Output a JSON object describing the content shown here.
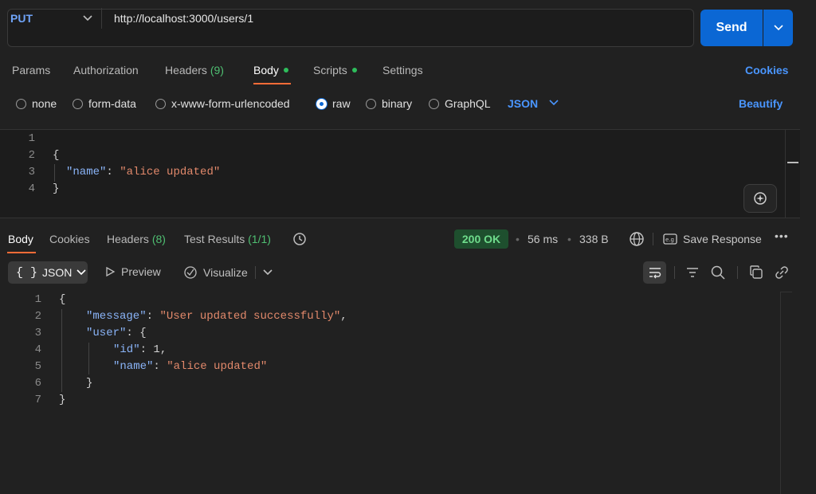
{
  "request": {
    "method": "PUT",
    "url": "http://localhost:3000/users/1",
    "send_label": "Send"
  },
  "request_tabs": [
    {
      "label": "Params"
    },
    {
      "label": "Authorization"
    },
    {
      "label": "Headers",
      "count": "(9)"
    },
    {
      "label": "Body",
      "active": true
    },
    {
      "label": "Scripts"
    },
    {
      "label": "Settings"
    }
  ],
  "cookies_label": "Cookies",
  "body_types": [
    "none",
    "form-data",
    "x-www-form-urlencoded",
    "raw",
    "binary",
    "GraphQL"
  ],
  "selected_body_type": "raw",
  "raw_format": "JSON",
  "beautify_label": "Beautify",
  "request_body": {
    "line_numbers": [
      "1",
      "2",
      "3",
      "4"
    ],
    "key": "\"name\"",
    "value": "\"alice updated\""
  },
  "response_tabs": [
    {
      "label": "Body",
      "active": true
    },
    {
      "label": "Cookies"
    },
    {
      "label": "Headers",
      "count": "(8)"
    },
    {
      "label": "Test Results",
      "count": "(1/1)"
    }
  ],
  "response_meta": {
    "status": "200 OK",
    "time": "56 ms",
    "size": "338 B",
    "save_label": "Save Response"
  },
  "response_toolbar": {
    "format": "JSON",
    "preview": "Preview",
    "visualize": "Visualize"
  },
  "response_body": {
    "line_numbers": [
      "1",
      "2",
      "3",
      "4",
      "5",
      "6",
      "7"
    ],
    "message_key": "\"message\"",
    "message_value": "\"User updated successfully\"",
    "user_key": "\"user\"",
    "id_key": "\"id\"",
    "id_value": "1",
    "name_key": "\"name\"",
    "name_value": "\"alice updated\""
  },
  "colors": {
    "accent": "#0b67d4",
    "tab_underline": "#ff6c37",
    "status_bg": "#1e4f2e",
    "status_text": "#6fdc8c",
    "json_key": "#8ab4f8",
    "json_string": "#e2896b"
  }
}
